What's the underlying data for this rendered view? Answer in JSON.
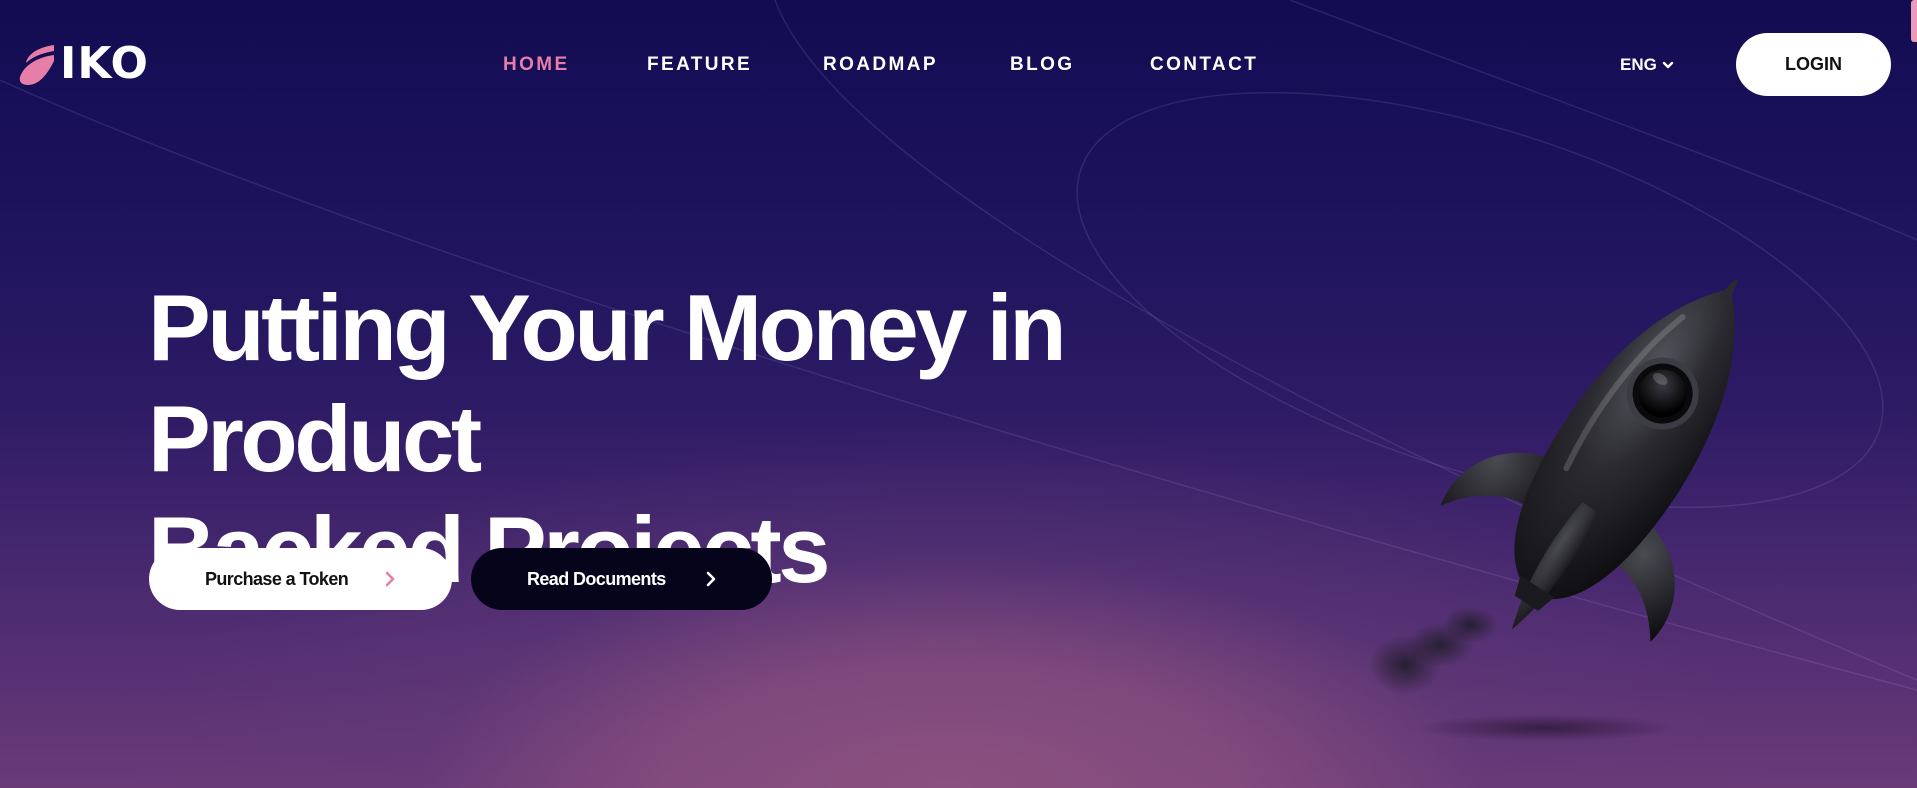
{
  "brand": {
    "logo_text": "IKO",
    "logo_icon": "flame-logo-icon",
    "accent_color": "#e67ea8"
  },
  "nav": {
    "items": [
      {
        "label": "HOME",
        "active": true
      },
      {
        "label": "FEATURE",
        "active": false
      },
      {
        "label": "ROADMAP",
        "active": false
      },
      {
        "label": "BLOG",
        "active": false
      },
      {
        "label": "CONTACT",
        "active": false
      }
    ]
  },
  "language": {
    "selected": "ENG",
    "icon": "chevron-down-icon"
  },
  "login": {
    "label": "LOGIN"
  },
  "hero": {
    "headline_line1": "Putting Your Money in Product",
    "headline_line2": "Backed Projects",
    "primary_button": {
      "label": "Purchase a Token",
      "icon": "chevron-right-icon"
    },
    "secondary_button": {
      "label": "Read Documents",
      "icon": "chevron-right-icon"
    },
    "illustration": "rocket-illustration"
  }
}
